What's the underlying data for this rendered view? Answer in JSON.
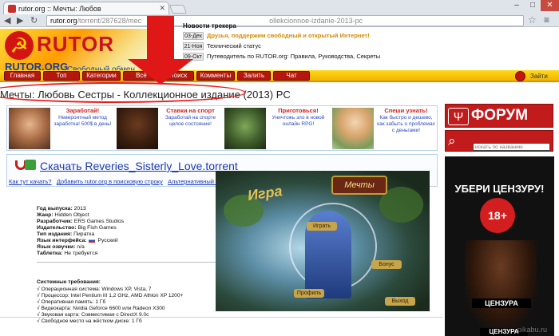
{
  "browser": {
    "tab_title": "rutor.org :: Мечты: Любов",
    "url_host": "rutor.org",
    "url_path": "/torrent/287628/mec",
    "url_tail": "ollekcionnoe-izdanie-2013-pc",
    "buttons": {
      "back": "◀",
      "forward": "▶",
      "reload": "↻",
      "star": "☆",
      "menu": "≡"
    },
    "window": {
      "minimize": "–",
      "maximize": "□",
      "close": "✕"
    }
  },
  "site": {
    "logo_title": "RUTOR",
    "logo_domain": "RUTOR.ORG",
    "slogan": "Свободный обмен"
  },
  "news": {
    "header": "Новости трекера",
    "items": [
      {
        "date": "03-Дек",
        "text": "Друзья, поддержим свободный и открытый Интернет!",
        "highlight": true
      },
      {
        "date": "21-Ноя",
        "text": "Технический статус",
        "highlight": false
      },
      {
        "date": "09-Окт",
        "text": "Путеводитель по RUTOR.org: Правила, Руководства, Секреты",
        "highlight": false
      }
    ]
  },
  "topnav": {
    "items": [
      "Главная",
      "Топ",
      "Категории",
      "Всё",
      "Поиск",
      "Комменты",
      "Залить",
      "Чат"
    ],
    "exit": "Зайти"
  },
  "page_title": "Мечты: Любовь Сестры - Коллекционное издание (2013) PC",
  "banners": [
    {
      "title": "Заработай!",
      "desc": "Невероятный метод заработка! 500$ в день!"
    },
    {
      "title": "Ставки на спорт",
      "desc": "Заработай на спорте целое состояние!"
    },
    {
      "title": "Приготовься!",
      "desc": "Уничтожь зло в новой онлайн RPG!"
    },
    {
      "title": "Спеши узнать!",
      "desc": "Как быстро и дешево, как забыть о проблемах с деньгами!"
    }
  ],
  "sidebar": {
    "forum": "ФОРУМ",
    "search_placeholder": "искать по названию",
    "censorship_title": "УБЕРИ ЦЕНЗУРУ!",
    "age": "18+",
    "censored": "ЦЕНЗУРА",
    "censored2": "ЦЕНЗУРА"
  },
  "download": {
    "link": "Скачать Reveries_Sisterly_Love.torrent",
    "how": "Как тут качать?",
    "add_search": "Добавить rutor.org в поисковую строку",
    "alt": "Альтернативный .torrent файл (если обычный не качает)!",
    "alt_suffix": "[?]"
  },
  "info": [
    {
      "label": "Год выпуска:",
      "value": " 2013"
    },
    {
      "label": "Жанр:",
      "value": " Hidden Object"
    },
    {
      "label": "Разработчик:",
      "value": " ERS Games Studios"
    },
    {
      "label": "Издательство:",
      "value": " Big Fish Games"
    },
    {
      "label": "Тип издания:",
      "value": " Пиратка"
    },
    {
      "label": "Язык интерфейса:",
      "value": " Русский"
    },
    {
      "label": "Язык озвучки:",
      "value": " n/a"
    },
    {
      "label": "Таблетка:",
      "value": " Не требуется"
    }
  ],
  "sysreq": {
    "title": "Системные требования:",
    "items": [
      "√ Операционная система: Windows XP, Vista, 7",
      "√ Процессор: Intel Pentium III 1,2 GHz, AMD Athlon XP 1200+",
      "√ Оперативная память: 1 Гб",
      "√ Видеокарта: Nvidia Geforce 6600 или Radeon X300",
      "√ Звуковая карта: Совместимая с DirectX 9.0c",
      "√ Свободное место на жёстком диске: 1 Гб"
    ]
  },
  "screenshot": {
    "sign": "Мечты",
    "igra": "Игра",
    "b1": "Профиль",
    "b2": "Бонус",
    "b3": "Выход",
    "b4": "Играть"
  },
  "watermark": "pikabu.ru"
}
